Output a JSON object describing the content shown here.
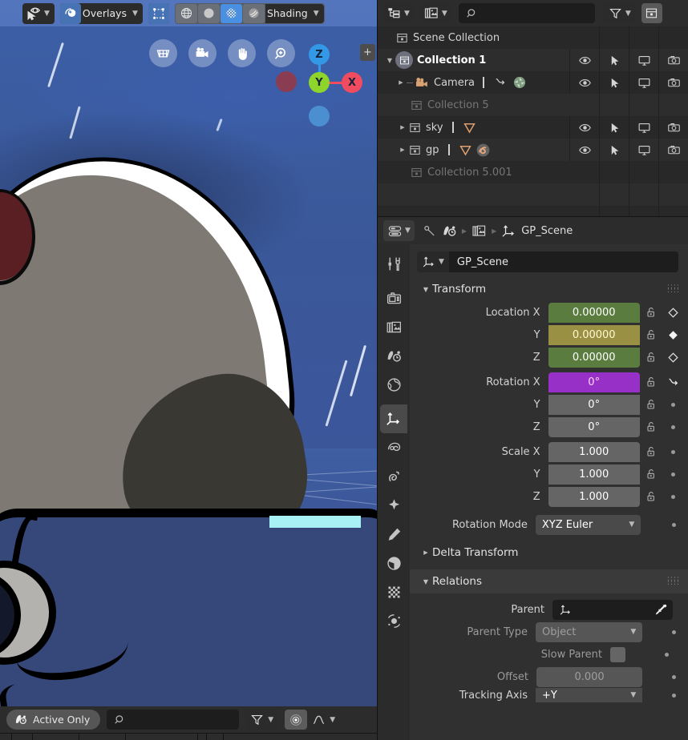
{
  "viewport": {
    "header": {
      "gizmo_label": "",
      "overlays_label": "Overlays",
      "shading_label": "Shading",
      "icons": {
        "gizmo": "gizmo-cursor-icon",
        "overlays": "overlays-sphere-icon",
        "xray": "xray-toggle-icon",
        "wireframe": "shading-wireframe-icon",
        "solid": "shading-solid-icon",
        "material": "shading-material-preview-icon",
        "rendered": "shading-rendered-icon"
      },
      "shading_active": "material"
    },
    "nav_buttons": [
      {
        "name": "view-grid-button",
        "icon": "grid-icon"
      },
      {
        "name": "camera-view-button",
        "icon": "camera-icon"
      },
      {
        "name": "pan-view-button",
        "icon": "hand-icon"
      },
      {
        "name": "zoom-view-button",
        "icon": "magnifier-plus-icon"
      }
    ],
    "axis_gizmo": {
      "z_label": "Z",
      "y_label": "Y",
      "x_label": "X",
      "z_color": "#3399e6",
      "y_color": "#8fd42a",
      "x_color": "#f04b5e",
      "neg_x_color": "#8a3d52",
      "neg_z_color": "#4b8fd0"
    },
    "plus_badge": "+",
    "footer": {
      "active_only_label": "Active Only",
      "active_only_icon": "onion-skin-icon",
      "search_placeholder": "",
      "filter_icon": "filter-funnel-icon",
      "proportional_icon": "proportional-editing-icon",
      "falloff_icon": "falloff-curve-icon",
      "proportional_enabled": true
    }
  },
  "outliner": {
    "header": {
      "display_mode_icon": "outliner-tree-icon",
      "scene_data_icon": "scene-data-icon",
      "search_placeholder": "",
      "search_icon": "search-icon",
      "filter_icon": "filter-funnel-icon",
      "new_collection_icon": "new-collection-icon"
    },
    "restriction_icons": [
      "eye-icon",
      "cursor-select-icon",
      "monitor-icon",
      "camera-render-icon"
    ],
    "rows": [
      {
        "name": "Scene Collection",
        "indent": 0,
        "icon": "collection-icon",
        "triangle": "none",
        "selected": false,
        "disabled": false,
        "restrictions": false,
        "extras": []
      },
      {
        "name": "Collection 1",
        "indent": 1,
        "icon": "collection-highlight-icon",
        "triangle": "down",
        "selected": true,
        "disabled": false,
        "restrictions": true,
        "extras": []
      },
      {
        "name": "Camera",
        "indent": 2,
        "icon": "camera-object-icon",
        "triangle": "right-small",
        "selected": false,
        "disabled": false,
        "restrictions": true,
        "extras": [
          "constraint-icon",
          "camera-data-icon"
        ]
      },
      {
        "name": "Collection 5",
        "indent": 1,
        "icon": "collection-icon",
        "triangle": "none",
        "selected": false,
        "disabled": true,
        "restrictions": false,
        "extras": []
      },
      {
        "name": "sky",
        "indent": 1,
        "icon": "collection-icon",
        "triangle": "right",
        "selected": false,
        "disabled": false,
        "restrictions": true,
        "extras": [
          "grease-pencil-icon"
        ]
      },
      {
        "name": "gp",
        "indent": 1,
        "icon": "collection-icon",
        "triangle": "right",
        "selected": false,
        "disabled": false,
        "restrictions": true,
        "extras": [
          "grease-pencil-icon",
          "modifier-icon"
        ]
      },
      {
        "name": "Collection 5.001",
        "indent": 1,
        "icon": "collection-icon",
        "triangle": "none",
        "selected": false,
        "disabled": true,
        "restrictions": false,
        "extras": []
      }
    ]
  },
  "properties": {
    "header": {
      "editor_type_icon": "properties-editor-icon",
      "breadcrumb": [
        {
          "icon": "tool-icon",
          "label": ""
        },
        {
          "icon": "render-icon",
          "label": ""
        },
        {
          "icon": "view-layer-icon",
          "label": ""
        },
        {
          "icon": "object-axes-icon",
          "label": "GP_Scene"
        }
      ]
    },
    "tabs": [
      {
        "name": "tool",
        "icon": "tool-icon",
        "active": false
      },
      {
        "name": "render",
        "icon": "render-camera-icon",
        "active": false
      },
      {
        "name": "output",
        "icon": "output-printer-icon",
        "active": false
      },
      {
        "name": "view-layer",
        "icon": "view-layer-images-icon",
        "active": false
      },
      {
        "name": "scene",
        "icon": "scene-cone-icon",
        "active": false
      },
      {
        "name": "world",
        "icon": "world-globe-icon",
        "active": false
      },
      {
        "name": "object",
        "icon": "object-axes-icon",
        "active": true
      },
      {
        "name": "modifiers",
        "icon": "modifier-wrench-icon",
        "active": false
      },
      {
        "name": "particles",
        "icon": "particles-icon",
        "active": false
      },
      {
        "name": "physics",
        "icon": "physics-orbit-icon",
        "active": false
      },
      {
        "name": "constraints",
        "icon": "constraint-icon",
        "active": false
      },
      {
        "name": "object-data",
        "icon": "object-data-icon",
        "active": false
      },
      {
        "name": "material",
        "icon": "material-sphere-icon",
        "active": false
      },
      {
        "name": "texture",
        "icon": "texture-checker-icon",
        "active": false
      }
    ],
    "id_bar": {
      "icon": "object-axes-icon",
      "value": "GP_Scene"
    },
    "transform_panel": {
      "title": "Transform",
      "expanded": true,
      "rows": [
        {
          "label": "Location X",
          "value": "0.00000",
          "style": "grn",
          "lock": "unlocked",
          "anim": "keyframe-hollow"
        },
        {
          "label": "Y",
          "value": "0.00000",
          "style": "olv",
          "lock": "unlocked",
          "anim": "keyframe-filled"
        },
        {
          "label": "Z",
          "value": "0.00000",
          "style": "grn",
          "lock": "unlocked",
          "anim": "keyframe-hollow"
        },
        {
          "label": "Rotation X",
          "value": "0°",
          "style": "pur",
          "lock": "unlocked",
          "anim": "driver-arrow"
        },
        {
          "label": "Y",
          "value": "0°",
          "style": "grey",
          "lock": "unlocked",
          "anim": "dot"
        },
        {
          "label": "Z",
          "value": "0°",
          "style": "grey",
          "lock": "unlocked",
          "anim": "dot"
        },
        {
          "label": "Scale X",
          "value": "1.000",
          "style": "grey",
          "lock": "unlocked",
          "anim": "dot"
        },
        {
          "label": "Y",
          "value": "1.000",
          "style": "grey",
          "lock": "unlocked",
          "anim": "dot"
        },
        {
          "label": "Z",
          "value": "1.000",
          "style": "grey",
          "lock": "unlocked",
          "anim": "dot"
        }
      ],
      "rotation_mode": {
        "label": "Rotation Mode",
        "value": "XYZ Euler",
        "anim": "dot"
      }
    },
    "delta_transform_panel": {
      "title": "Delta Transform",
      "expanded": false
    },
    "relations_panel": {
      "title": "Relations",
      "expanded": true,
      "parent": {
        "label": "Parent",
        "value": "",
        "icon": "object-axes-icon",
        "eyedropper": "eyedropper-icon"
      },
      "parent_type": {
        "label": "Parent Type",
        "value": "Object",
        "anim": "dot"
      },
      "slow_parent": {
        "label": "Slow Parent",
        "checked": false,
        "anim": "dot"
      },
      "offset": {
        "label": "Offset",
        "value": "0.000",
        "anim": "dot"
      },
      "tracking_axis": {
        "label": "Tracking Axis",
        "value": "+Y",
        "anim": "dot"
      }
    }
  },
  "colors": {
    "accent_blue": "#4772b3",
    "keyframe_green": "#5a7c3f",
    "keyframe_olive": "#9a9044",
    "driver_purple": "#9730c6",
    "viewport_sky": "#3b5a9e"
  }
}
